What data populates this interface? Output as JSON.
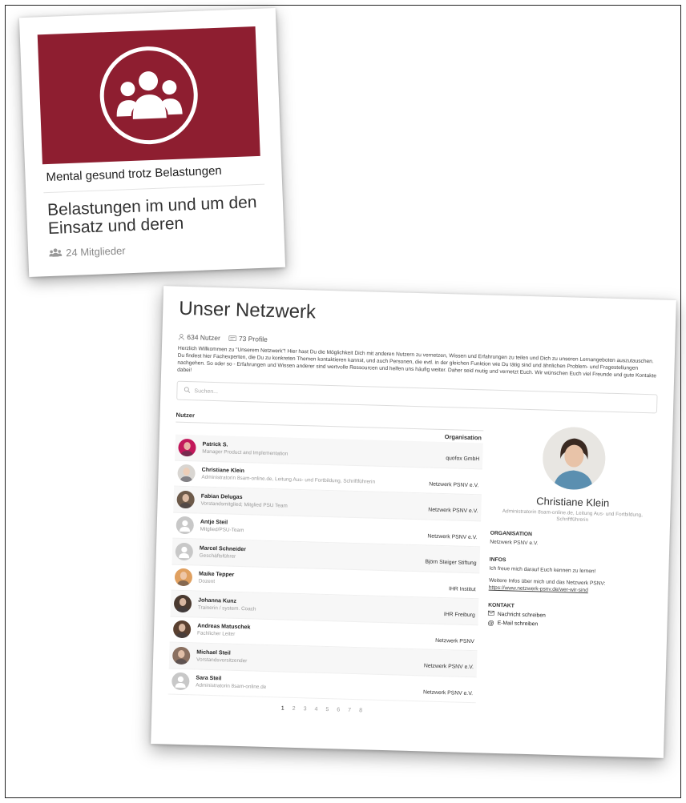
{
  "card": {
    "category": "Mental gesund trotz Belastungen",
    "title": "Belastungen im und um den Einsatz und deren",
    "members": "24 Mitglieder",
    "hero_color": "#8e1e30",
    "icon": "group-icon"
  },
  "network": {
    "title": "Unser Netzwerk",
    "stats": {
      "users": "634 Nutzer",
      "profiles": "73 Profile"
    },
    "intro": "Herzlich Willkommen zu \"Unserem Netzwerk\"! Hier hast Du die Möglichkeit Dich mit anderen Nutzern zu vernetzen, Wissen und Erfahrungen zu teilen und Dich zu unseren Lernangeboten auszutauschen. Du findest hier Fachexperten, die Du zu konkreten Themen kontaktieren kannst, und auch Personen, die evtl. in der gleichen Funktion wie Du tätig sind und ähnlichen Problem- und Fragestellungen nachgehen. So oder so - Erfahrungen und Wissen anderer sind wertvolle Ressourcen und helfen uns häufig weiter. Daher seid mutig und vernetzt Euch. Wir wünschen Euch viel Freunde und gute Kontakte dabei!",
    "search_placeholder": "Suchen...",
    "table": {
      "section_label": "Nutzer",
      "col_org": "Organisation",
      "rows": [
        {
          "name": "Patrick S.",
          "role": "Manager Product and Implementation",
          "org": "quofox GmbH",
          "avatar": "#c2185b"
        },
        {
          "name": "Christiane Klein",
          "role": "Administratorin 8sam-online.de, Leitung Aus- und Fortbildung, Schriftführerin",
          "org": "Netzwerk PSNV e.V.",
          "avatar": "#d9d6d2"
        },
        {
          "name": "Fabian Delugas",
          "role": "Vorstandsmitglied; Mitglied PSU Team",
          "org": "Netzwerk PSNV e.V.",
          "avatar": "#6d5a4a"
        },
        {
          "name": "Antje Steil",
          "role": "Mitglied/PSU-Team",
          "org": "Netzwerk PSNV e.V.",
          "avatar": "placeholder"
        },
        {
          "name": "Marcel Schneider",
          "role": "Geschäftsführer",
          "org": "Björn Steiger Stiftung",
          "avatar": "placeholder"
        },
        {
          "name": "Maike Tepper",
          "role": "Dozent",
          "org": "IHR Institut",
          "avatar": "#e0a060"
        },
        {
          "name": "Johanna Kunz",
          "role": "Trainerin / system. Coach",
          "org": "IHR Freiburg",
          "avatar": "#4a3a30"
        },
        {
          "name": "Andreas Matuschek",
          "role": "Fachlicher Leiter",
          "org": "Netzwerk PSNV",
          "avatar": "#5a4030"
        },
        {
          "name": "Michael Steil",
          "role": "Vorstandsvorsitzender",
          "org": "Netzwerk PSNV e.V.",
          "avatar": "#8a7060"
        },
        {
          "name": "Sara Steil",
          "role": "Administratorin 8sam-online.de",
          "org": "Netzwerk PSNV e.V.",
          "avatar": "placeholder"
        }
      ]
    },
    "pagination": [
      "1",
      "2",
      "3",
      "4",
      "5",
      "6",
      "7",
      "8"
    ],
    "profile": {
      "name": "Christiane Klein",
      "subtitle": "Administratorin 8sam-online.de, Leitung Aus- und Fortbildung, Schriftführerin",
      "org_label": "ORGANISATION",
      "org_value": "Netzwerk PSNV e.V.",
      "infos_label": "INFOS",
      "infos_line1": "Ich freue mich darauf Euch kennen zu lernen!",
      "infos_line2": "Weitere Infos über mich und das Netzwerk PSNV:",
      "infos_link": "https://www.netzwerk-psnv.de/wer-wir-sind",
      "contact_label": "KONTAKT",
      "contact_message": "Nachricht schreiben",
      "contact_email": "E-Mail schreiben"
    }
  }
}
